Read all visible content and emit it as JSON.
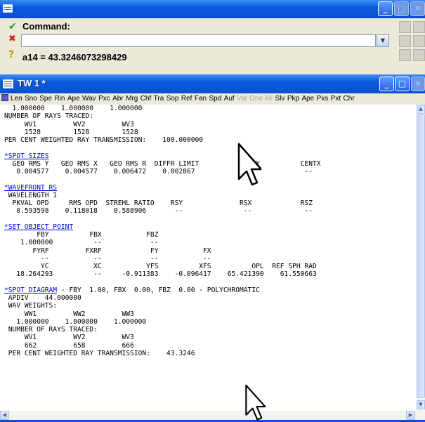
{
  "command_window": {
    "label": "Command:",
    "input_value": "",
    "result_text": "a14 = 43.3246073298429",
    "icons": {
      "sys": "list-icon",
      "ok": "check-icon",
      "cancel": "x-icon",
      "query": "question-icon"
    }
  },
  "text_window": {
    "title": "TW 1 *",
    "toolbar": [
      {
        "label": "Len",
        "enabled": true
      },
      {
        "label": "Sno",
        "enabled": true
      },
      {
        "label": "Spe",
        "enabled": true
      },
      {
        "label": "Rin",
        "enabled": true
      },
      {
        "label": "Ape",
        "enabled": true
      },
      {
        "label": "Wav",
        "enabled": true
      },
      {
        "label": "Pxc",
        "enabled": true
      },
      {
        "label": "Abr",
        "enabled": true
      },
      {
        "label": "Mrg",
        "enabled": true
      },
      {
        "label": "Chf",
        "enabled": true
      },
      {
        "label": "Tra",
        "enabled": true
      },
      {
        "label": "Sop",
        "enabled": true
      },
      {
        "label": "Ref",
        "enabled": true
      },
      {
        "label": "Fan",
        "enabled": true
      },
      {
        "label": "Spd",
        "enabled": true
      },
      {
        "label": "Auf",
        "enabled": true
      },
      {
        "label": "Var",
        "enabled": false
      },
      {
        "label": "One",
        "enabled": false
      },
      {
        "label": "Ile",
        "enabled": false
      },
      {
        "label": "Slv",
        "enabled": true
      },
      {
        "label": "Pkp",
        "enabled": true
      },
      {
        "label": "Ape",
        "enabled": true
      },
      {
        "label": "Pxs",
        "enabled": true
      },
      {
        "label": "Pxt",
        "enabled": true
      },
      {
        "label": "Chr",
        "enabled": true
      }
    ],
    "lines": [
      "  1.000000    1.000000    1.000000",
      "NUMBER OF RAYS TRACED:",
      "     WV1         WV2         WV3",
      "     1528        1528        1528",
      "PER CENT WEIGHTED RAY TRANSMISSION:    100.000000",
      "",
      {
        "link": "*SPOT SIZES",
        "rest": ""
      },
      "  GEO RMS Y   GEO RMS X   GEO RMS R  DIFFR LIMIT          CENTY          CENTX",
      "   0.004577    0.004577    0.006472    0.002867            --             --",
      "",
      {
        "link": "*WAVEFRONT RS",
        "rest": ""
      },
      " WAVELENGTH 1",
      "  PKVAL OPD     RMS OPD  STREHL RATIO    RSY              RSX            RSZ",
      "   0.593598    0.118018    0.588906       --               --             --",
      "",
      {
        "link": "*SET OBJECT POINT",
        "rest": ""
      },
      "        FBY          FBX           FBZ",
      "    1.000000          --            --",
      "       FYRF         FXRF            FY           FX",
      "         --           --            --           --",
      "         YC           XC           YFS          XFS          OPL  REF SPH RAD",
      "   18.264293          --     -0.911383    -0.096417    65.421390    61.550663",
      "",
      {
        "link": "*SPOT DIAGRAM",
        "rest": " - FBY  1.00, FBX  0.00, FBZ  0.00 - POLYCHROMATIC"
      },
      " APDIV    44.000000",
      " WAV WEIGHTS:",
      "     WW1         WW2         WW3",
      "   1.000000    1.000000    1.000000",
      " NUMBER OF RAYS TRACED:",
      "     WV1         WV2         WV3",
      "     662         658         666",
      " PER CENT WEIGHTED RAY TRANSMISSION:    43.3246"
    ]
  }
}
